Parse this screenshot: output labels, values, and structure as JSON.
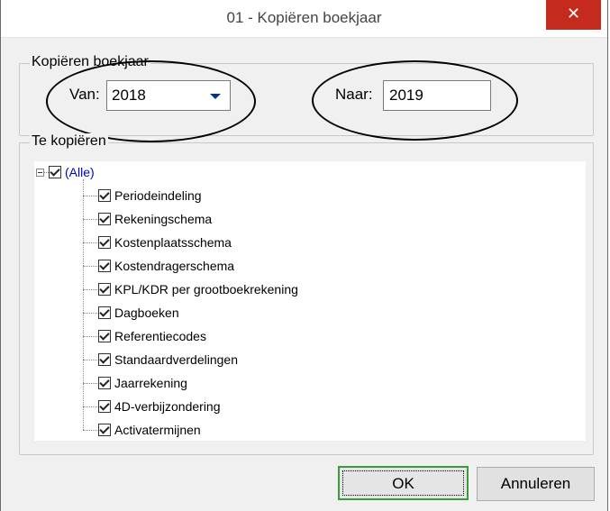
{
  "window": {
    "title": "01 - Kopiëren boekjaar",
    "close_glyph": "✕"
  },
  "copy_year": {
    "group_label": "Kopiëren boekjaar",
    "from_label": "Van:",
    "from_value": "2018",
    "to_label": "Naar:",
    "to_value": "2019"
  },
  "copy_items": {
    "group_label": "Te kopiëren",
    "root": {
      "label": "(Alle)",
      "checked": true,
      "expanded": true
    },
    "items": [
      {
        "label": "Periodeindeling",
        "checked": true
      },
      {
        "label": "Rekeningschema",
        "checked": true
      },
      {
        "label": "Kostenplaatsschema",
        "checked": true
      },
      {
        "label": "Kostendragerschema",
        "checked": true
      },
      {
        "label": "KPL/KDR per grootboekrekening",
        "checked": true
      },
      {
        "label": "Dagboeken",
        "checked": true
      },
      {
        "label": "Referentiecodes",
        "checked": true
      },
      {
        "label": "Standaardverdelingen",
        "checked": true
      },
      {
        "label": "Jaarrekening",
        "checked": true
      },
      {
        "label": "4D-verbijzondering",
        "checked": true
      },
      {
        "label": "Activatermijnen",
        "checked": true
      }
    ]
  },
  "buttons": {
    "ok": "OK",
    "cancel": "Annuleren"
  }
}
